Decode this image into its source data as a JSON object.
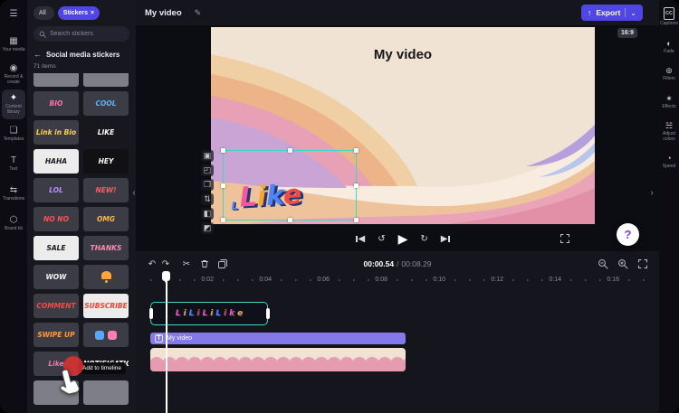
{
  "colors": {
    "accent": "#4f46e5",
    "selection": "#3ed8c3",
    "text_track": "#8478ea"
  },
  "header": {
    "tab_title": "My video",
    "edit_icon": "✎",
    "export_icon": "↑",
    "export_label": "Export",
    "export_chevron": "⌄",
    "aspect_badge": "16:9"
  },
  "left_nav": {
    "items": [
      {
        "name": "menu-button",
        "icon": "menu-icon",
        "glyph": "☰",
        "label": ""
      },
      {
        "name": "sidebar-item-your-media",
        "icon": "media-icon",
        "glyph": "▦",
        "label": "Your media"
      },
      {
        "name": "sidebar-item-record-create",
        "icon": "record-icon",
        "glyph": "◉",
        "label": "Record & create"
      },
      {
        "name": "sidebar-item-content-library",
        "icon": "content-library-icon",
        "glyph": "✦",
        "label": "Content library",
        "cls": "active"
      },
      {
        "name": "sidebar-item-templates",
        "icon": "templates-icon",
        "glyph": "❏",
        "label": "Templates"
      },
      {
        "name": "sidebar-item-text",
        "icon": "text-icon",
        "glyph": "T",
        "label": "Text"
      },
      {
        "name": "sidebar-item-transitions",
        "icon": "transitions-icon",
        "glyph": "⇆",
        "label": "Transitions"
      },
      {
        "name": "sidebar-item-brand-kit",
        "icon": "brand-kit-icon",
        "glyph": "⬡",
        "label": "Brand kit"
      }
    ]
  },
  "stickers_panel": {
    "filters": [
      {
        "label": "All"
      },
      {
        "label": "Stickers",
        "close": "×",
        "cls": "accent"
      }
    ],
    "search_placeholder": "Search stickers",
    "back_icon": "←",
    "category_title": "Social media stickers",
    "items_count": "71 items",
    "tooltip": "Add to timeline",
    "stickers": [
      {
        "label": "",
        "bg": "#7e7e88",
        "fg": "#7e7e88"
      },
      {
        "label": "",
        "bg": "#7e7e88",
        "fg": "#7e7e88"
      },
      {
        "label": "BIO",
        "bg": "#3c3c46",
        "fg": "#ff70ae"
      },
      {
        "label": "COOL",
        "bg": "#3c3c46",
        "fg": "#58b6ff"
      },
      {
        "label": "Link in Bio",
        "bg": "#3c3c46",
        "fg": "#ffd24a"
      },
      {
        "label": "LIKE",
        "bg": "#17171d",
        "fg": "#ffffff"
      },
      {
        "label": "HAHA",
        "bg": "#ececec",
        "fg": "#17171d"
      },
      {
        "label": "HEY",
        "bg": "#111114",
        "fg": "#ffffff"
      },
      {
        "label": "LOL",
        "bg": "#3c3c46",
        "fg": "#b98cff"
      },
      {
        "label": "NEW!",
        "bg": "#3c3c46",
        "fg": "#ff5b69"
      },
      {
        "label": "NO NO",
        "bg": "#3c3c46",
        "fg": "#ff5252"
      },
      {
        "label": "OMG",
        "bg": "#3c3c46",
        "fg": "#ffb84a"
      },
      {
        "label": "SALE",
        "bg": "#ececec",
        "fg": "#17171d"
      },
      {
        "label": "THANKS",
        "bg": "#3c3c46",
        "fg": "#ff8ab0"
      },
      {
        "label": "WOW",
        "bg": "#3c3c46",
        "fg": "#f5f5f5"
      },
      {
        "label": "",
        "bg": "#3c3c46",
        "cls": "bell"
      },
      {
        "label": "COMMENT",
        "bg": "#3c3c46",
        "fg": "#ff4646"
      },
      {
        "label": "SUBSCRIBE",
        "bg": "#ececec",
        "fg": "#ff3b30"
      },
      {
        "label": "SWIPE UP",
        "bg": "#3c3c46",
        "fg": "#ff9b3d"
      },
      {
        "label": "",
        "bg": "#3c3c46",
        "cls": "thumbs"
      },
      {
        "label": "Like",
        "bg": "#3c3c46",
        "fg": "#ff70ae"
      },
      {
        "label": "NOTIFICATION",
        "bg": "#17171d",
        "fg": "#ffffff"
      },
      {
        "label": "",
        "bg": "#7e7e88",
        "fg": "#7e7e88"
      },
      {
        "label": "",
        "bg": "#7e7e88",
        "fg": "#7e7e88"
      }
    ]
  },
  "preview": {
    "video_title": "My video",
    "sticker_small_letter": "L",
    "sticker_letters": [
      {
        "ch": "L",
        "color": "#f4579a"
      },
      {
        "ch": "i",
        "color": "#f8a72c"
      },
      {
        "ch": "k",
        "color": "#4f86f7"
      },
      {
        "ch": "e",
        "color": "#ef4b43"
      }
    ],
    "tools": [
      {
        "name": "transform-icon",
        "glyph": "▣"
      },
      {
        "name": "crop-icon",
        "glyph": "◰"
      },
      {
        "name": "duplicate-icon",
        "glyph": "❐"
      },
      {
        "name": "flip-icon",
        "glyph": "⇅"
      },
      {
        "name": "volume-icon",
        "glyph": "◧"
      },
      {
        "name": "opacity-icon",
        "glyph": "◩"
      }
    ]
  },
  "playback": {
    "rewind_glyph": "↺",
    "play_glyph": "▶",
    "forward_glyph": "↻",
    "skip_glyph_left": "◀",
    "skip_glyph_right": "▶"
  },
  "timeline": {
    "undo_glyph": "↶",
    "redo_glyph": "↷",
    "split_glyph": "✂",
    "current_time": "00:00.54",
    "time_separator": "/",
    "total_time": "00:08.29",
    "ruler_labels": [
      "0:02",
      "0:04",
      "0:06",
      "0:08",
      "0:10",
      "0:12",
      "0:14",
      "0:16"
    ],
    "sticker_clip_letters": [
      {
        "ch": "L",
        "color": "#f4579a"
      },
      {
        "ch": "i",
        "color": "#f8a72c"
      },
      {
        "ch": "L",
        "color": "#4f86f7"
      },
      {
        "ch": "i",
        "color": "#ef4b43"
      },
      {
        "ch": "L",
        "color": "#f4579a"
      },
      {
        "ch": "i",
        "color": "#f8a72c"
      },
      {
        "ch": "L",
        "color": "#4f86f7"
      },
      {
        "ch": "i",
        "color": "#ef4b43"
      },
      {
        "ch": "k",
        "color": "#f4579a"
      },
      {
        "ch": "e",
        "color": "#f8a72c"
      }
    ],
    "text_track_icon": "T",
    "text_track_label": "My video"
  },
  "right_toolbar": {
    "items": [
      {
        "name": "captions-icon",
        "glyph": "CC",
        "label": "Captions",
        "cls": "boxed"
      },
      {
        "name": "fade-icon",
        "glyph": "◐",
        "label": "Fade"
      },
      {
        "name": "filters-icon",
        "glyph": "⊚",
        "label": "Filters"
      },
      {
        "name": "effects-icon",
        "glyph": "✶",
        "label": "Effects"
      },
      {
        "name": "adjust-colors-icon",
        "glyph": "☵",
        "label": "Adjust colors"
      },
      {
        "name": "speed-icon",
        "glyph": "◔",
        "label": "Speed"
      }
    ]
  },
  "floating": {
    "help_label": "?",
    "collapse_left": "‹",
    "collapse_right": "›"
  }
}
